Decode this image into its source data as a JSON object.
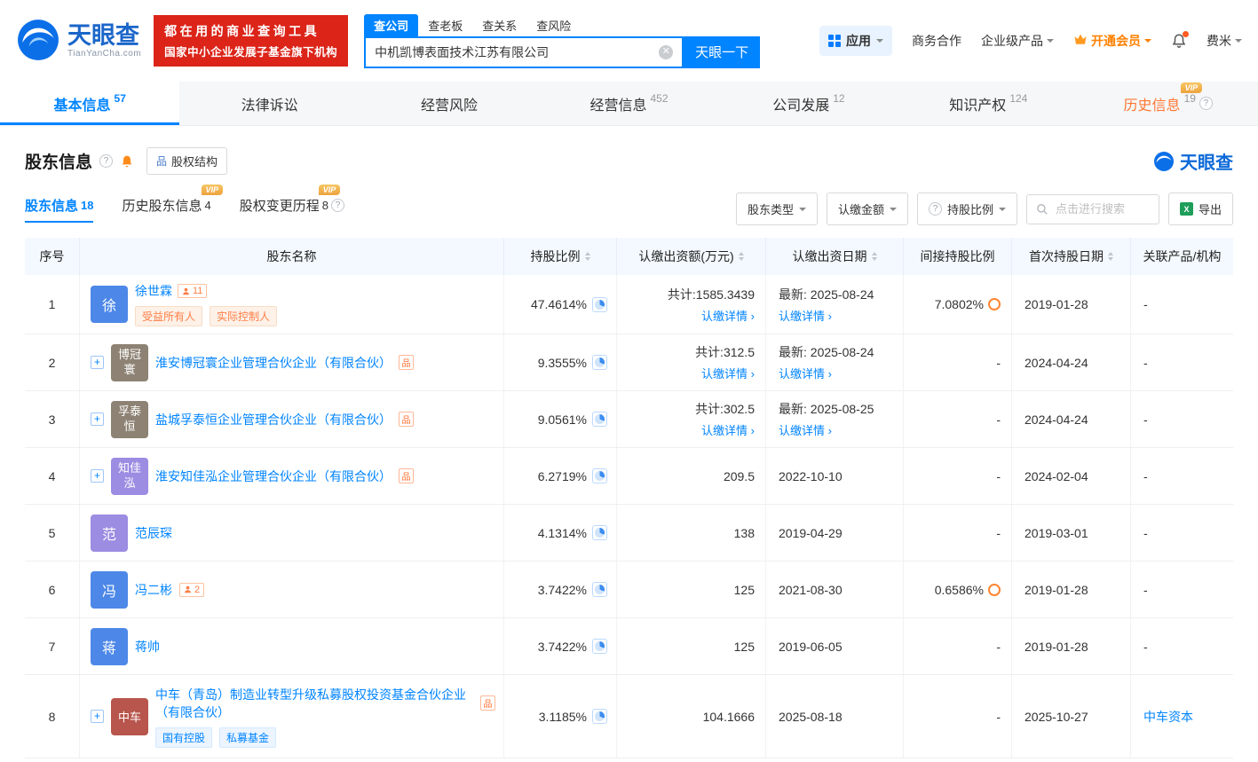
{
  "colors": {
    "primary_blue": "#0084ff",
    "banner_red": "#dc2419",
    "vip_gold": "#efb347",
    "member_orange": "#ff8000",
    "tag_orange": "#ff7e45",
    "history_tab_orange": "#ff7733",
    "table_header_bg": "#f3f9ff",
    "excel_green": "#1e9e5a"
  },
  "vip_label": "VIP",
  "header": {
    "logo_name": "天眼查",
    "logo_domain": "TianYanCha.com",
    "banner_line1": "都在用的商业查询工具",
    "banner_line2": "国家中小企业发展子基金旗下机构",
    "search_tabs": [
      {
        "label": "查公司"
      },
      {
        "label": "查老板"
      },
      {
        "label": "查关系"
      },
      {
        "label": "查风险"
      }
    ],
    "search_value": "中机凯博表面技术江苏有限公司",
    "search_button": "天眼一下",
    "nav": {
      "app": "应用",
      "cooperation": "商务合作",
      "enterprise": "企业级产品",
      "vip": "开通会员",
      "user": "费米"
    }
  },
  "tabs": [
    {
      "label": "基本信息",
      "count": "57"
    },
    {
      "label": "法律诉讼",
      "count": ""
    },
    {
      "label": "经营风险",
      "count": ""
    },
    {
      "label": "经营信息",
      "count": "452"
    },
    {
      "label": "公司发展",
      "count": "12"
    },
    {
      "label": "知识产权",
      "count": "124"
    },
    {
      "label": "历史信息",
      "count": "19"
    }
  ],
  "section": {
    "title": "股东信息",
    "equity_button": "股权结构",
    "logo": "天眼查"
  },
  "subtabs": [
    {
      "label": "股东信息",
      "count": "18"
    },
    {
      "label": "历史股东信息",
      "count": "4"
    },
    {
      "label": "股权变更历程",
      "count": "8"
    }
  ],
  "filters": {
    "shareholder_type": "股东类型",
    "subscribed_amount": "认缴金额",
    "shareholding_ratio": "持股比例",
    "search_placeholder": "点击进行搜索",
    "export": "导出"
  },
  "table": {
    "headers": [
      "序号",
      "股东名称",
      "持股比例",
      "认缴出资额(万元)",
      "认缴出资日期",
      "间接持股比例",
      "首次持股日期",
      "关联产品/机构"
    ],
    "rows": [
      {
        "no": "1",
        "avatar": "徐",
        "avatar_style": "background:#4d88e8",
        "name": "徐世霖",
        "badge": "11",
        "tags": [
          "受益所有人",
          "实际控制人"
        ],
        "ratio": "47.4614%",
        "capital": "共计:1585.3439",
        "capital_link": "认缴详情 ›",
        "date": "最新: 2025-08-24",
        "date_link": "认缴详情 ›",
        "indirect": "7.0802%",
        "first_date": "2019-01-28",
        "related": "-"
      },
      {
        "no": "2",
        "avatar": "博冠寰",
        "avatar_style": "background:#8d8273",
        "name": "淮安博冠寰企业管理合伙企业（有限合伙）",
        "ratio": "9.3555%",
        "capital": "共计:312.5",
        "capital_link": "认缴详情 ›",
        "date": "最新: 2025-08-24",
        "date_link": "认缴详情 ›",
        "indirect": "-",
        "first_date": "2024-04-24",
        "related": "-"
      },
      {
        "no": "3",
        "avatar": "孚泰恒",
        "avatar_style": "background:#8d8273",
        "name": "盐城孚泰恒企业管理合伙企业（有限合伙）",
        "ratio": "9.0561%",
        "capital": "共计:302.5",
        "capital_link": "认缴详情 ›",
        "date": "最新: 2025-08-25",
        "date_link": "认缴详情 ›",
        "indirect": "-",
        "first_date": "2024-04-24",
        "related": "-"
      },
      {
        "no": "4",
        "avatar": "知佳泓",
        "avatar_style": "background:#9c8ce2",
        "name": "淮安知佳泓企业管理合伙企业（有限合伙）",
        "ratio": "6.2719%",
        "capital": "209.5",
        "date": "2022-10-10",
        "indirect": "-",
        "first_date": "2024-02-04",
        "related": "-"
      },
      {
        "no": "5",
        "avatar": "范",
        "avatar_style": "background:#9c8ce2",
        "name": "范辰琛",
        "ratio": "4.1314%",
        "capital": "138",
        "date": "2019-04-29",
        "indirect": "-",
        "first_date": "2019-03-01",
        "related": "-"
      },
      {
        "no": "6",
        "avatar": "冯",
        "avatar_style": "background:#4d88e8",
        "name": "冯二彬",
        "badge": "2",
        "ratio": "3.7422%",
        "capital": "125",
        "date": "2021-08-30",
        "indirect": "0.6586%",
        "first_date": "2019-01-28",
        "related": "-"
      },
      {
        "no": "7",
        "avatar": "蒋",
        "avatar_style": "background:#4d88e8",
        "name": "蒋帅",
        "ratio": "3.7422%",
        "capital": "125",
        "date": "2019-06-05",
        "indirect": "-",
        "first_date": "2019-01-28",
        "related": "-"
      },
      {
        "no": "8",
        "avatar": "中车",
        "avatar_style": "background:#b8554c",
        "name": "中车（青岛）制造业转型升级私募股权投资基金合伙企业（有限合伙）",
        "tags": [
          "国有控股",
          "私募基金"
        ],
        "ratio": "3.1185%",
        "capital": "104.1666",
        "date": "2025-08-18",
        "indirect": "-",
        "first_date": "2025-10-27",
        "related": "中车资本"
      }
    ]
  }
}
